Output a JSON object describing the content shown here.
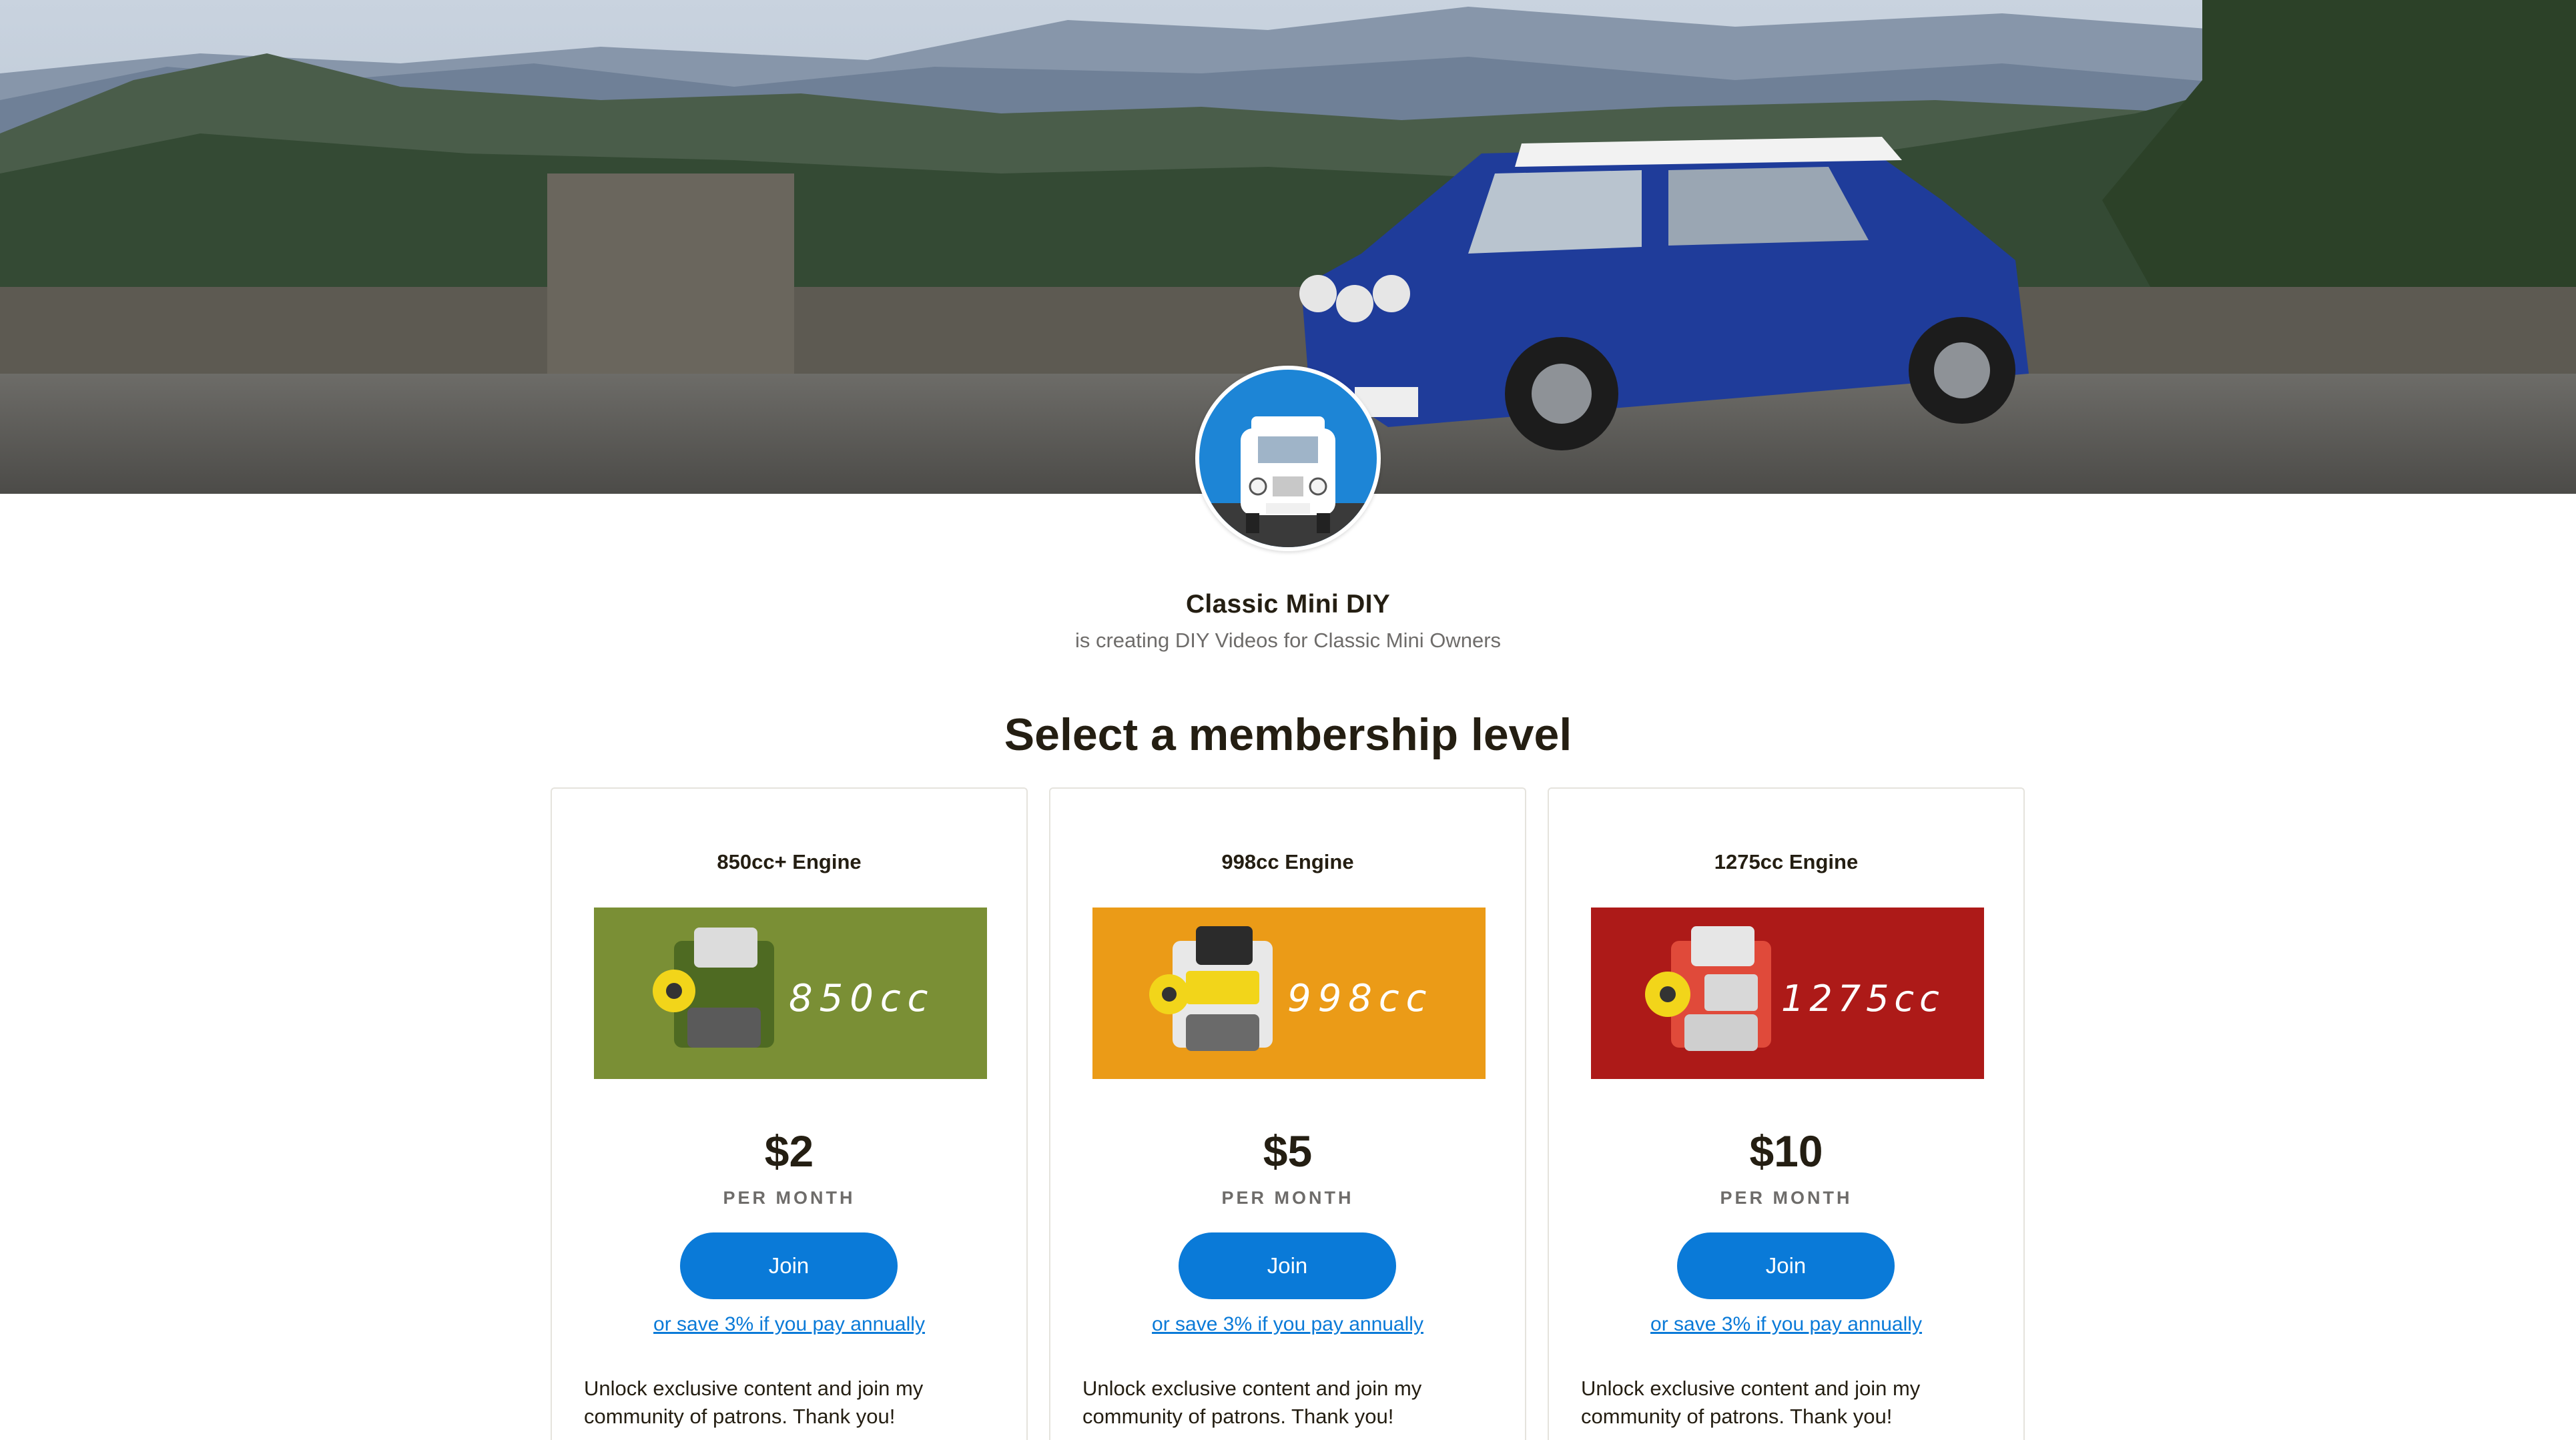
{
  "creator": {
    "name": "Classic Mini DIY",
    "tagline": "is creating DIY Videos for Classic Mini Owners"
  },
  "section_title": "Select a membership level",
  "tiers": [
    {
      "title": "850cc+ Engine",
      "image_text": "850cc",
      "image_color": "#7a8f35",
      "price": "$2",
      "period": "PER MONTH",
      "join_label": "Join",
      "annual_link": "or save 3% if you pay annually",
      "description": "Unlock exclusive content and join my community of patrons. Thank you!"
    },
    {
      "title": "998cc Engine",
      "image_text": "998cc",
      "image_color": "#eb9b17",
      "price": "$5",
      "period": "PER MONTH",
      "join_label": "Join",
      "annual_link": "or save 3% if you pay annually",
      "description": "Unlock exclusive content and join my community of patrons. Thank you!"
    },
    {
      "title": "1275cc Engine",
      "image_text": "1275cc",
      "image_color": "#ad1a18",
      "price": "$10",
      "period": "PER MONTH",
      "join_label": "Join",
      "annual_link": "or save 3% if you pay annually",
      "description": "Unlock exclusive content and join my community of patrons. Thank you!"
    }
  ],
  "colors": {
    "accent": "#0a7ad8",
    "text": "#241e12",
    "muted": "#6e6c6a"
  },
  "icons": {
    "cover": "mountain-road-mini-photo",
    "avatar": "blue-mini-front-avatar",
    "tier_images": [
      "engine-850cc-image",
      "engine-998cc-image",
      "engine-1275cc-image"
    ]
  }
}
